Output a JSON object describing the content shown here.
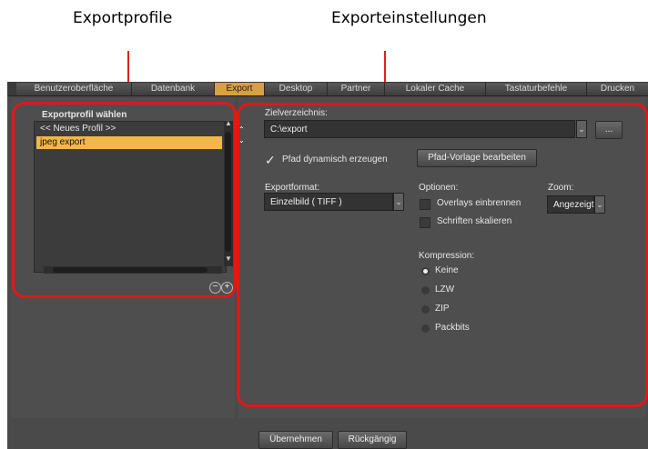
{
  "annotations": {
    "left_label": "Exportprofile",
    "right_label": "Exporteinstellungen"
  },
  "tabs": [
    "Benutzeroberfläche",
    "Datenbank",
    "Export",
    "Desktop",
    "Partner",
    "Lokaler Cache",
    "Tastaturbefehle",
    "Drucken"
  ],
  "active_tab": "Export",
  "profiles": {
    "title": "Exportprofil wählen",
    "items": [
      "<< Neues Profil >>",
      "jpeg export"
    ],
    "selected": "jpeg export",
    "remove_label": "−",
    "add_label": "+"
  },
  "target": {
    "label": "Zielverzeichnis:",
    "value": "C:\\export",
    "browse_label": "..."
  },
  "dynamic_path": {
    "label": "Pfad dynamisch erzeugen",
    "checked": true,
    "template_button": "Pfad-Vorlage bearbeiten"
  },
  "format": {
    "label": "Exportformat:",
    "value": "Einzelbild ( TIFF )"
  },
  "options": {
    "label": "Optionen:",
    "items": [
      "Overlays einbrennen",
      "Schriften skalieren"
    ]
  },
  "zoom": {
    "label": "Zoom:",
    "value": "Angezeigt"
  },
  "compression": {
    "label": "Kompression:",
    "items": [
      "Keine",
      "LZW",
      "ZIP",
      "Packbits"
    ],
    "selected": "Keine"
  },
  "footer": {
    "apply": "Übernehmen",
    "undo": "Rückgängig"
  }
}
